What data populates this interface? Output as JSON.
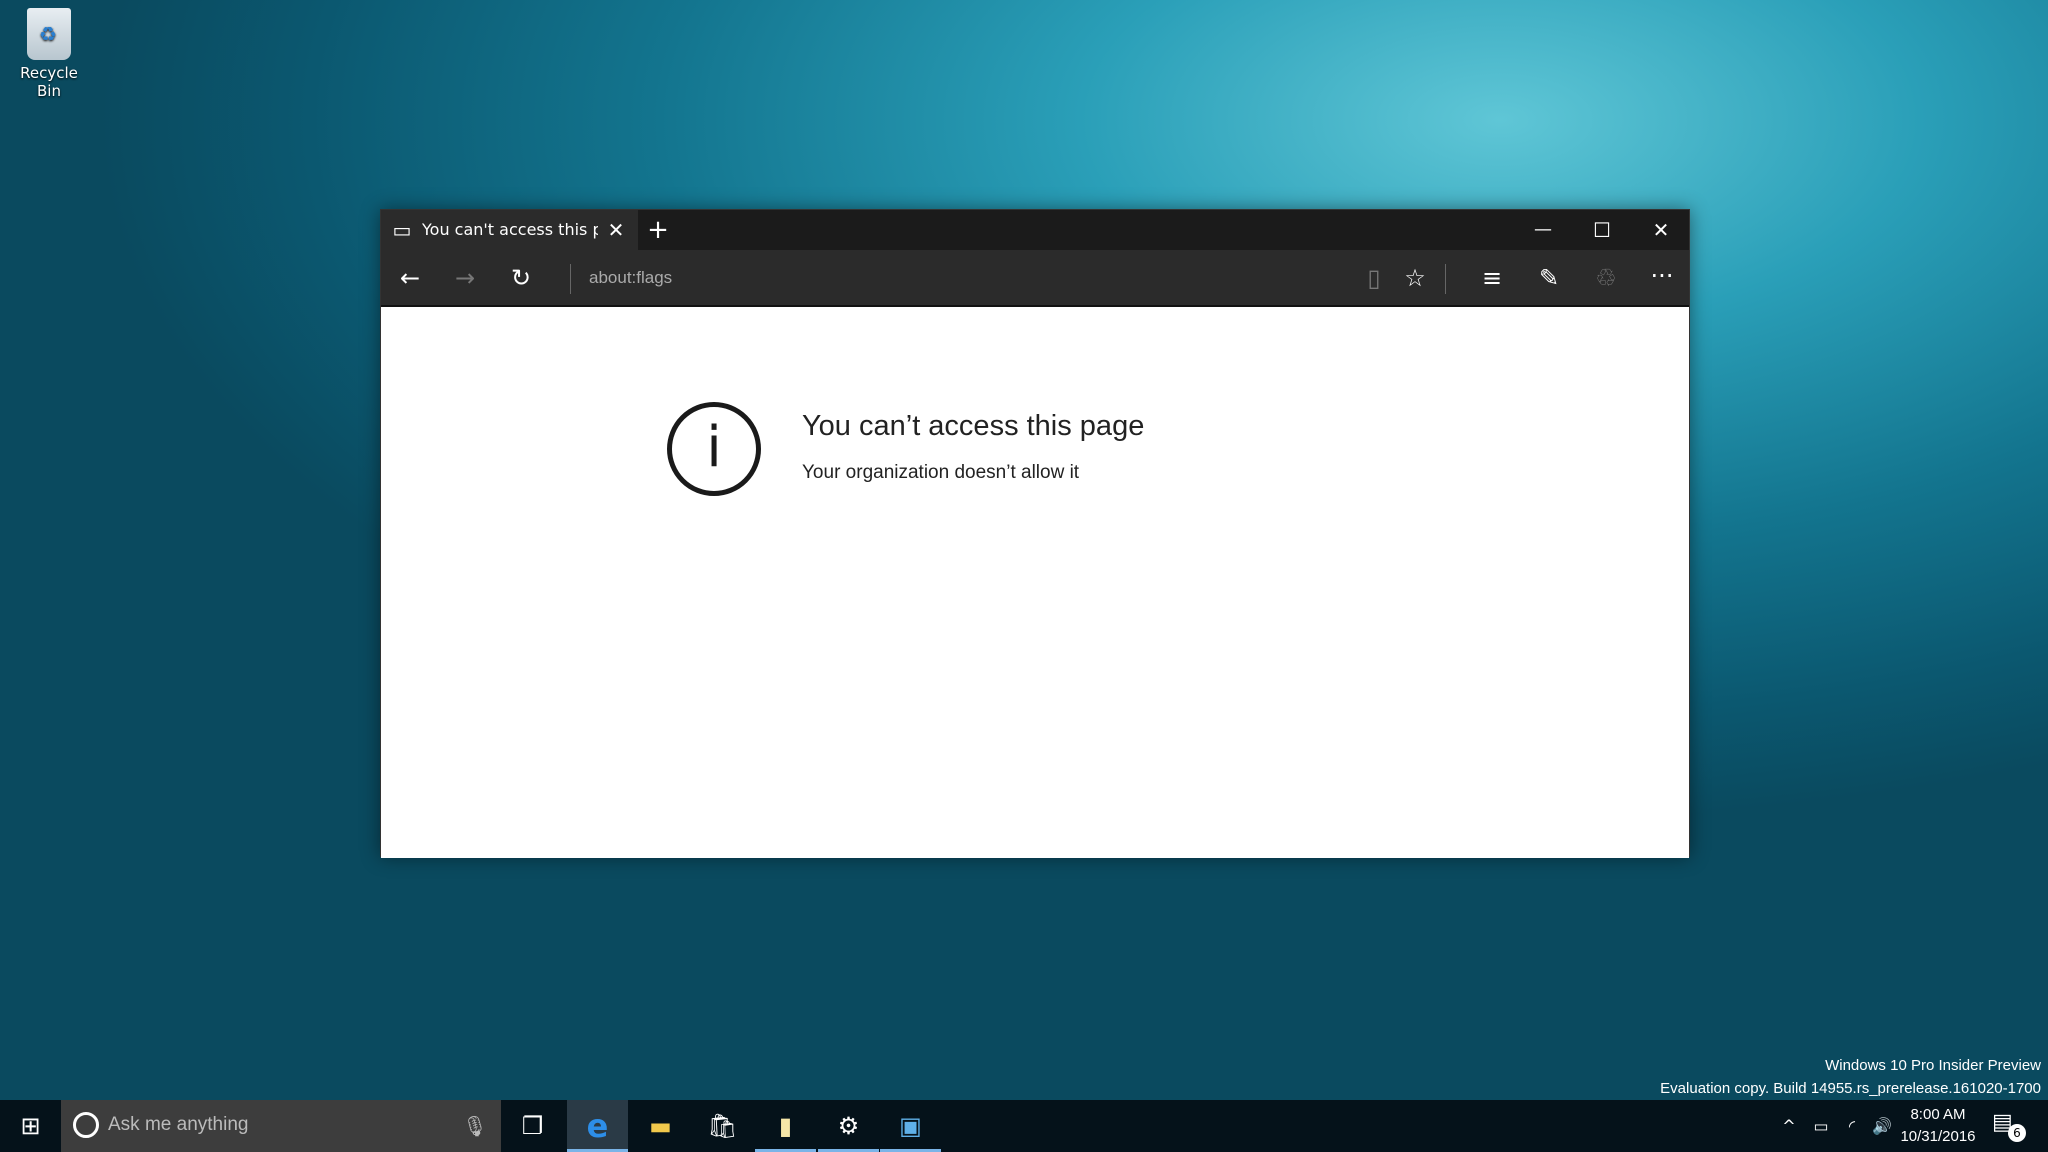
{
  "desktop": {
    "recycle_bin_label": "Recycle Bin"
  },
  "browser": {
    "tab_title": "You can't access this pa",
    "address": "about:flags",
    "icons": [
      "tab-icon",
      "close-icon",
      "plus-icon",
      "minimize-icon",
      "maximize-icon",
      "close-icon",
      "back-icon",
      "forward-icon",
      "refresh-icon",
      "reading-view-icon",
      "star-icon",
      "hub-icon",
      "web-note-icon",
      "share-icon",
      "more-icon"
    ]
  },
  "page": {
    "title": "You can’t access this page",
    "subtitle": "Your organization doesn’t allow it",
    "icon": "info-icon"
  },
  "watermark": {
    "line1": "Windows 10 Pro Insider Preview",
    "line2": "Evaluation copy. Build 14955.rs_prerelease.161020-1700"
  },
  "taskbar": {
    "search_placeholder": "Ask me anything",
    "time": "8:00 AM",
    "date": "10/31/2016",
    "notification_count": "6",
    "accent": "#7ab4e8"
  }
}
